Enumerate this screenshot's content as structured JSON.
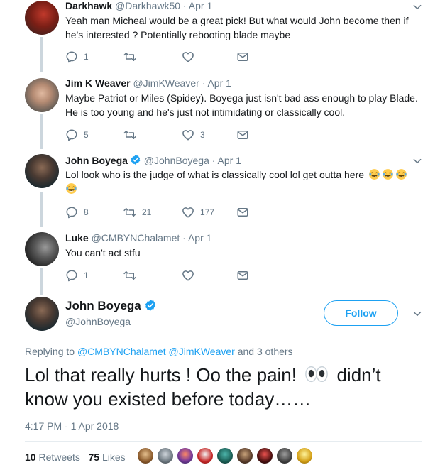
{
  "colors": {
    "link": "#1da1f2",
    "muted": "#657786",
    "text": "#14171a",
    "line": "#ccd6dd"
  },
  "replies": [
    {
      "name": "Darkhawk",
      "handle": "@Darkhawk50",
      "sep": "·",
      "date": "Apr 1",
      "verified": false,
      "lines": [
        "Yeah man Micheal would be a great pick! But what would John become then if",
        "he's interested ? Potentially rebooting blade maybe"
      ],
      "reply_count": "1",
      "retweet_count": "",
      "like_count": ""
    },
    {
      "name": "Jim K Weaver",
      "handle": "@JimKWeaver",
      "sep": "·",
      "date": "Apr 1",
      "verified": false,
      "lines": [
        "Maybe Patriot or Miles (Spidey). Boyega just isn't bad ass enough to play Blade.",
        "He is too young and he's just not intimidating or classically cool."
      ],
      "reply_count": "5",
      "retweet_count": "",
      "like_count": "3"
    },
    {
      "name": "John Boyega",
      "handle": "@JohnBoyega",
      "sep": "·",
      "date": "Apr 1",
      "verified": true,
      "lines": [
        "Lol look who is the judge of what is classically cool lol get outta here"
      ],
      "reply_count": "8",
      "retweet_count": "21",
      "like_count": "177"
    },
    {
      "name": "Luke",
      "handle": "@CMBYNChalamet",
      "sep": "·",
      "date": "Apr 1",
      "verified": false,
      "lines": [
        "You can't act stfu"
      ],
      "reply_count": "1",
      "retweet_count": "",
      "like_count": ""
    }
  ],
  "main": {
    "name": "John Boyega",
    "handle": "@JohnBoyega",
    "follow_label": "Follow",
    "replying_prefix": "Replying to",
    "replying_user1": "@CMBYNChalamet",
    "replying_user2": "@JimKWeaver",
    "replying_suffix": "and 3 others",
    "text_line1_a": "Lol that really hurts ! Oo the pain!",
    "text_line1_b": "didn’t",
    "text_line2": "know you existed before today……",
    "timestamp": "4:17 PM - 1 Apr 2018",
    "retweets_count": "10",
    "retweets_label": "Retweets",
    "likes_count": "75",
    "likes_label": "Likes"
  },
  "icons": {
    "reply": "reply-icon",
    "retweet": "retweet-icon",
    "like": "heart-icon",
    "dm": "envelope-icon",
    "caret": "chevron-down-icon",
    "verified": "verified-badge-icon",
    "emoji_laugh": "tears-of-joy-emoji",
    "emoji_eyes": "eyes-emoji"
  }
}
